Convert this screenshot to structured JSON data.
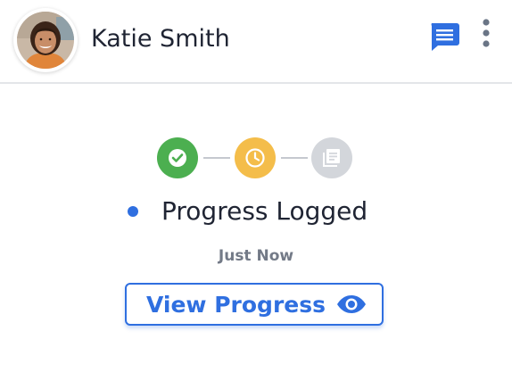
{
  "header": {
    "user_name": "Katie Smith",
    "avatar": "user-avatar-photo",
    "chat_icon": "chat-icon",
    "more_icon": "more-vertical-icon"
  },
  "stepper": {
    "steps": [
      {
        "icon": "check-icon",
        "state": "complete",
        "color": "#4caf50"
      },
      {
        "icon": "clock-icon",
        "state": "pending",
        "color": "#f4bd4a"
      },
      {
        "icon": "document-list-icon",
        "state": "inactive",
        "color": "#d3d6db"
      }
    ]
  },
  "status": {
    "label": "Progress Logged",
    "time": "Just Now",
    "dot_color": "#2f6fe0"
  },
  "action": {
    "label": "View Progress",
    "icon": "eye-icon"
  },
  "colors": {
    "accent": "#2f6fe0",
    "text": "#1f2433",
    "muted": "#737a87"
  }
}
